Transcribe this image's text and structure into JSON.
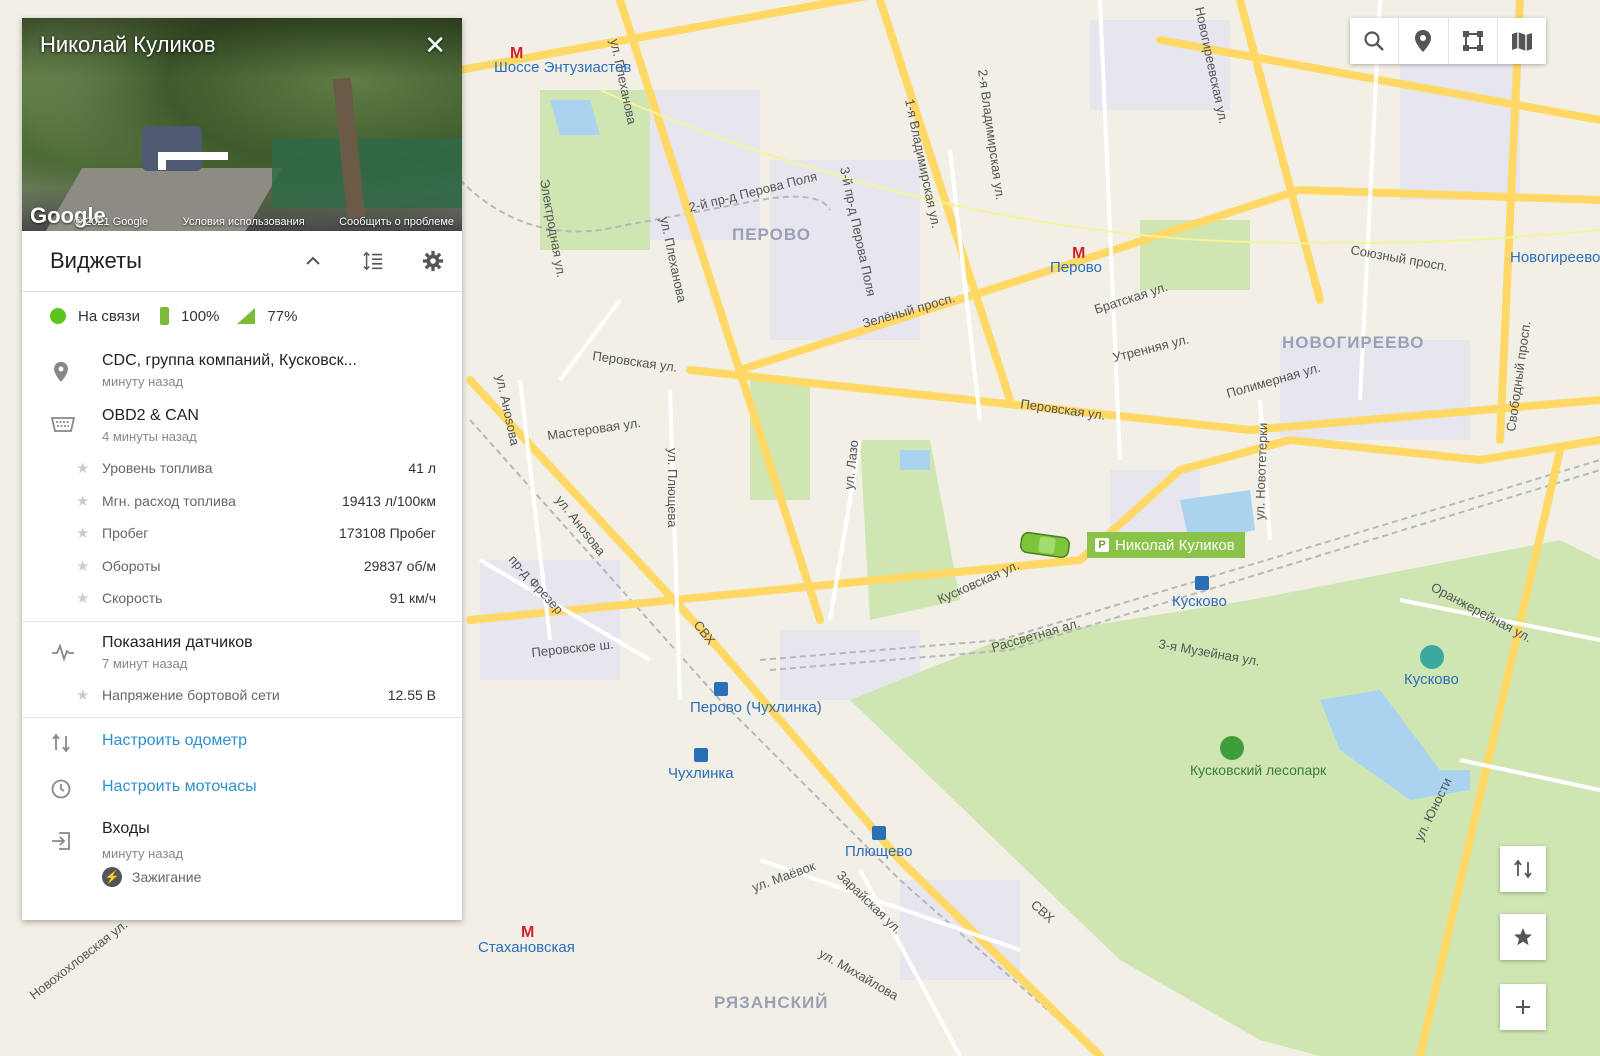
{
  "map": {
    "districts": [
      "ПЕРОВО",
      "НОВОГИРЕЕВО",
      "РЯЗАНСКИЙ"
    ],
    "streets": [
      "ул. Плеханова",
      "1-я Владимирская ул.",
      "2-я Владимирская ул.",
      "Новогиреевская ул.",
      "Зелёный просп.",
      "Перовская ул.",
      "Перовская ул.",
      "Мастеровая ул.",
      "Братская ул.",
      "Утренняя ул.",
      "Полимерная ул.",
      "Союзный просп.",
      "Кусковская ул.",
      "Рассветная ал.",
      "3-я Музейная ул.",
      "Оранжерейная ул.",
      "ул. Юности",
      "ул. Плющева",
      "ул. Лазо",
      "ул. Анosoва",
      "ул. Анosoва",
      "ул. Маёвок",
      "ул. Михайлова",
      "Зарайская ул.",
      "пр-д Фрезер",
      "Перовское ш.",
      "Свободный просп.",
      "ул. Новотетерки",
      "Электродная ул.",
      "3-й пр-д Перова Поля",
      "2-й пр-д Перова Поля",
      "СВХ",
      "СВХ",
      "ул. Плеханова",
      "Новохохловская ул."
    ],
    "stations": [
      "Шоссе Энтузиастов",
      "Перово",
      "Кусково",
      "Перово (Чухлинка)",
      "Чухлинка",
      "Плющево",
      "Стахановская",
      "Кусково",
      "Новогиреево"
    ],
    "park": "Кусковский лесопарк"
  },
  "vehicle": {
    "label": "Николай Куликов",
    "parking_letter": "P"
  },
  "panel": {
    "photo": {
      "title": "Николай Куликов",
      "close": "✕",
      "google": "Google",
      "copyright": "© 2021 Google",
      "terms": "Условия использования",
      "report": "Сообщить о проблеме"
    },
    "widgets_title": "Виджеты",
    "status": {
      "connection": "На связи",
      "battery": "100%",
      "signal": "77%"
    },
    "location": {
      "title": "CDC, группа компаний, Кусковск...",
      "time": "минуту назад"
    },
    "obd": {
      "title": "OBD2 & CAN",
      "time": "4 минуты назад",
      "rows": [
        {
          "label": "Уровень топлива",
          "value": "41 л"
        },
        {
          "label": "Мгн. расход топлива",
          "value": "19413 л/100км"
        },
        {
          "label": "Пробег",
          "value": "173108 Пробег"
        },
        {
          "label": "Обороты",
          "value": "29837 об/м"
        },
        {
          "label": "Скорость",
          "value": "91 км/ч"
        }
      ]
    },
    "sensors": {
      "title": "Показания датчиков",
      "time": "7 минут назад",
      "rows": [
        {
          "label": "Напряжение бортовой сети",
          "value": "12.55 В"
        }
      ]
    },
    "odometer_link": "Настроить одометр",
    "motohours_link": "Настроить моточасы",
    "inputs": {
      "title": "Входы",
      "time": "минуту назад",
      "ignition": "Зажигание"
    }
  }
}
